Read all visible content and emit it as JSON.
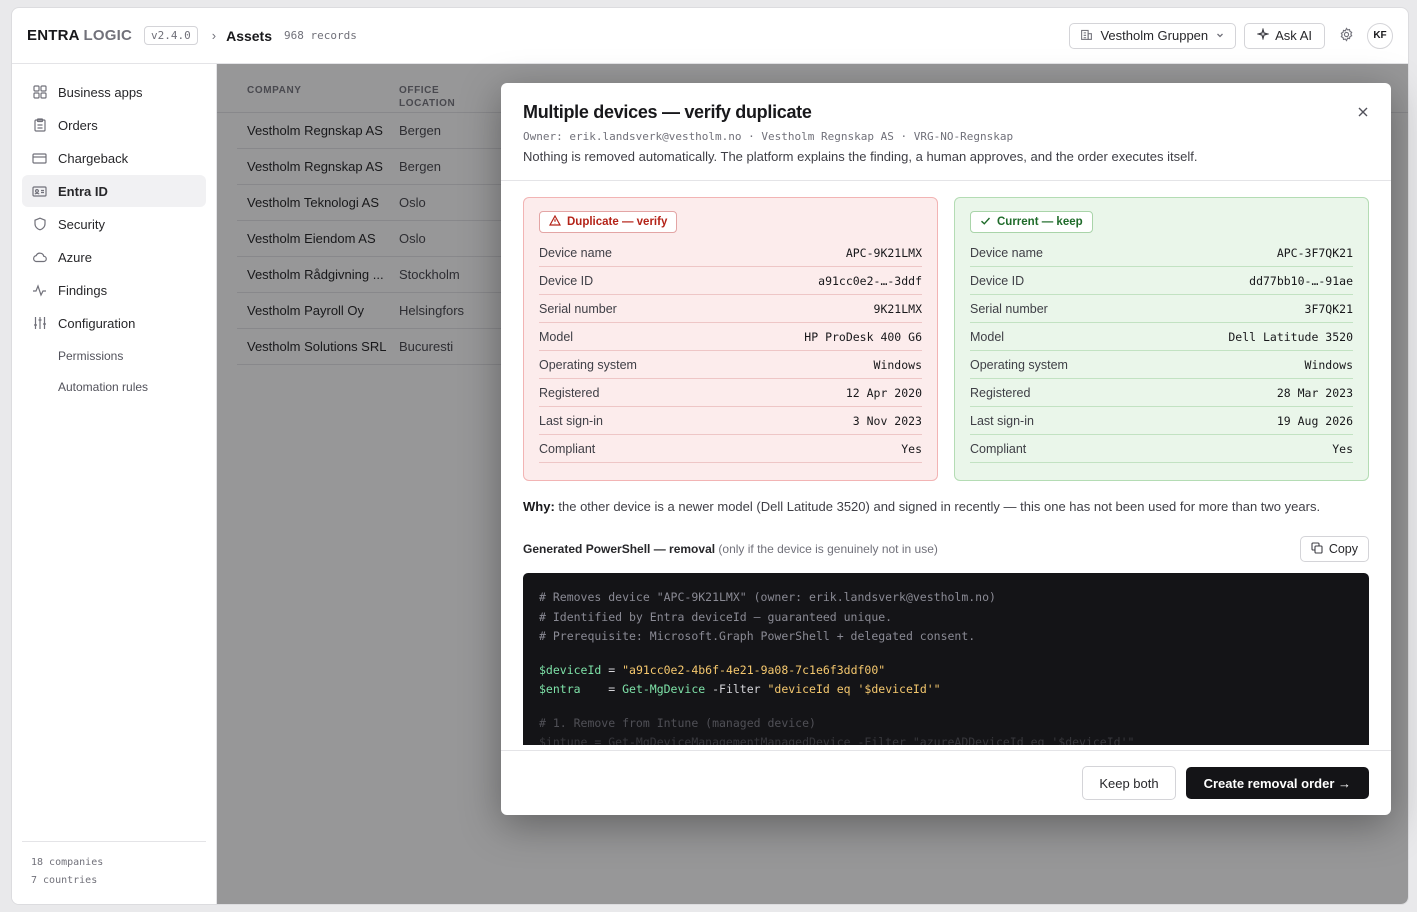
{
  "app": {
    "logo_a": "ENTRA",
    "logo_b": "LOGIC",
    "version": "v2.4.0",
    "breadcrumb_sep": "›",
    "page_title": "Assets",
    "record_count": "968 records"
  },
  "topbar": {
    "tenant": "Vestholm Gruppen",
    "ask_ai": "Ask AI",
    "avatar": "KF"
  },
  "sidebar": {
    "items": [
      {
        "label": "Business apps",
        "icon": "grid-icon"
      },
      {
        "label": "Orders",
        "icon": "clipboard-icon"
      },
      {
        "label": "Chargeback",
        "icon": "credit-card-icon"
      },
      {
        "label": "Entra ID",
        "icon": "id-card-icon",
        "active": true
      },
      {
        "label": "Security",
        "icon": "shield-icon"
      },
      {
        "label": "Azure",
        "icon": "cloud-icon"
      },
      {
        "label": "Findings",
        "icon": "activity-icon"
      },
      {
        "label": "Configuration",
        "icon": "sliders-icon"
      }
    ],
    "sub_items": [
      "Permissions",
      "Automation rules"
    ],
    "footer_companies": "18 companies",
    "footer_countries": "7 countries"
  },
  "table": {
    "headers": [
      "COMPANY",
      "OFFICE LOCATION"
    ],
    "rows": [
      [
        "Vestholm Regnskap AS",
        "Bergen"
      ],
      [
        "Vestholm Regnskap AS",
        "Bergen"
      ],
      [
        "Vestholm Teknologi AS",
        "Oslo"
      ],
      [
        "Vestholm Eiendom AS",
        "Oslo"
      ],
      [
        "Vestholm Rådgivning ...",
        "Stockholm"
      ],
      [
        "Vestholm Payroll Oy",
        "Helsingfors"
      ],
      [
        "Vestholm Solutions SRL",
        "Bucuresti"
      ]
    ]
  },
  "modal": {
    "title": "Multiple devices — verify duplicate",
    "meta": "Owner: erik.landsverk@vestholm.no · Vestholm Regnskap AS · VRG-NO-Regnskap",
    "description": "Nothing is removed automatically. The platform explains the finding, a human approves, and the order executes itself.",
    "duplicate": {
      "badge": "Duplicate — verify",
      "fields": [
        {
          "k": "Device name",
          "v": "APC-9K21LMX"
        },
        {
          "k": "Device ID",
          "v": "a91cc0e2-…-3ddf"
        },
        {
          "k": "Serial number",
          "v": "9K21LMX"
        },
        {
          "k": "Model",
          "v": "HP ProDesk 400 G6"
        },
        {
          "k": "Operating system",
          "v": "Windows"
        },
        {
          "k": "Registered",
          "v": "12 Apr 2020"
        },
        {
          "k": "Last sign-in",
          "v": "3 Nov 2023"
        },
        {
          "k": "Compliant",
          "v": "Yes"
        }
      ]
    },
    "current": {
      "badge": "Current — keep",
      "fields": [
        {
          "k": "Device name",
          "v": "APC-3F7QK21"
        },
        {
          "k": "Device ID",
          "v": "dd77bb10-…-91ae"
        },
        {
          "k": "Serial number",
          "v": "3F7QK21"
        },
        {
          "k": "Model",
          "v": "Dell Latitude 3520"
        },
        {
          "k": "Operating system",
          "v": "Windows"
        },
        {
          "k": "Registered",
          "v": "28 Mar 2023"
        },
        {
          "k": "Last sign-in",
          "v": "19 Aug 2026"
        },
        {
          "k": "Compliant",
          "v": "Yes"
        }
      ]
    },
    "why_label": "Why:",
    "why_text": " the other device is a newer model (Dell Latitude 3520) and signed in recently — this one has not been used for more than two years.",
    "ps_label": "Generated PowerShell — removal",
    "ps_note": " (only if the device is genuinely not in use)",
    "copy": "Copy",
    "code": {
      "c1": "# Removes device \"APC-9K21LMX\" (owner: erik.landsverk@vestholm.no)",
      "c2": "# Identified by Entra deviceId — guaranteed unique.",
      "c3": "# Prerequisite: Microsoft.Graph PowerShell + delegated consent.",
      "l1_var": "$deviceId",
      "l1_op": " = ",
      "l1_str": "\"a91cc0e2-4b6f-4e21-9a08-7c1e6f3ddf00\"",
      "l2_var": "$entra",
      "l2_op": "    = ",
      "l2_fn": "Get-MgDevice",
      "l2_arg": " -Filter ",
      "l2_str": "\"deviceId eq '$deviceId'\"",
      "c4": "# 1. Remove from Intune (managed device)",
      "l3": "$intune = Get-MgDeviceManagementManagedDevice -Filter \"azureADDeviceId eq '$deviceId'\""
    },
    "keep_both": "Keep both",
    "create_order": "Create removal order →"
  }
}
